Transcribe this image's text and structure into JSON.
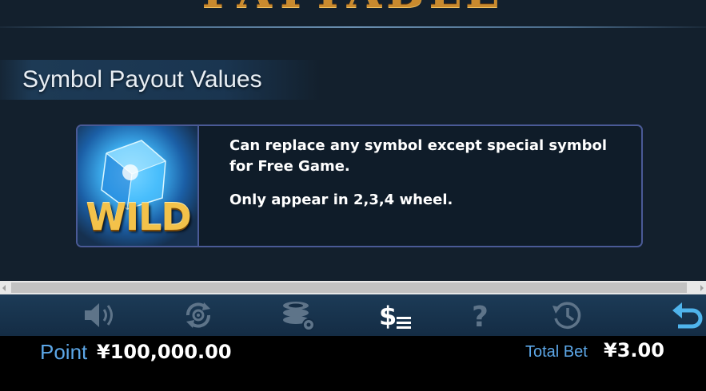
{
  "header": {
    "title": "PAYTABLE"
  },
  "section": {
    "title": "Symbol Payout Values"
  },
  "symbols": [
    {
      "icon": "wild-symbol",
      "label": "WILD",
      "description_line_1": "Can replace any symbol except special symbol for Free Game.",
      "description_line_2": "Only appear in 2,3,4 wheel."
    }
  ],
  "toolbar": {
    "items": [
      {
        "icon": "sound-icon",
        "active": false
      },
      {
        "icon": "autoplay-icon",
        "active": false
      },
      {
        "icon": "bet-settings-icon",
        "active": false
      },
      {
        "icon": "paytable-icon",
        "active": true
      },
      {
        "icon": "help-icon",
        "active": false
      },
      {
        "icon": "history-icon",
        "active": false
      },
      {
        "icon": "back-icon",
        "active": true
      }
    ]
  },
  "footer": {
    "point_label": "Point",
    "point_value": "¥100,000.00",
    "total_bet_label": "Total Bet",
    "total_bet_value": "¥3.00"
  },
  "colors": {
    "background": "#13202d",
    "card_border": "#4a5a96",
    "toolbar_icon_inactive": "#5e7489",
    "toolbar_icon_active": "#ffffff",
    "back_icon": "#4fb4ec",
    "footer_label": "#5ca6e6",
    "header_gold": "#c98a2e"
  }
}
